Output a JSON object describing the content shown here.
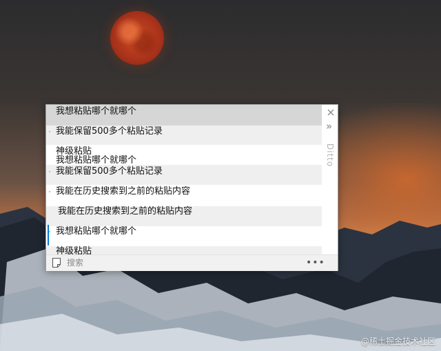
{
  "window": {
    "brand": "Ditto",
    "close_glyph": "×",
    "expand_glyph": "»",
    "more_glyph": "•••"
  },
  "clips": [
    "我想粘贴哪个就哪个",
    "我能保留500多个粘贴记录",
    "神级粘贴",
    "我想粘贴哪个就哪个",
    "我能保留500多个粘贴记录",
    "我能在历史搜索到之前的粘贴内容",
    "我能在历史搜索到之前的粘贴内容",
    "我想粘贴哪个就哪个",
    "神级粘贴"
  ],
  "search": {
    "placeholder": "搜索",
    "value": ""
  },
  "watermark": "@稀土掘金技术社区",
  "icons": {
    "close": "close-icon",
    "expand": "chevron-double-right-icon",
    "note": "note-icon",
    "more": "more-horizontal-icon"
  }
}
